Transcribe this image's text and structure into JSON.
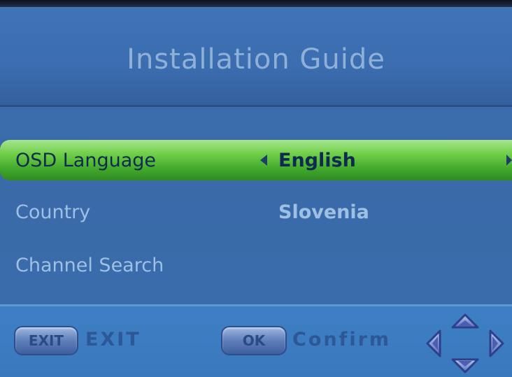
{
  "header": {
    "title": "Installation Guide"
  },
  "menu": {
    "items": [
      {
        "label": "OSD Language",
        "value": "English",
        "selected": true
      },
      {
        "label": "Country",
        "value": "Slovenia",
        "selected": false
      },
      {
        "label": "Channel Search",
        "value": "",
        "selected": false
      }
    ]
  },
  "footer": {
    "exit_key": "EXIT",
    "exit_label": "EXIT",
    "ok_key": "OK",
    "confirm_label": "Confirm",
    "dpad_icon": "dpad-navigation-icon"
  },
  "colors": {
    "background": "#3b6cab",
    "highlight": "#5ec23c",
    "title_text": "#8fb1d8",
    "item_text": "#9ec0e4"
  }
}
